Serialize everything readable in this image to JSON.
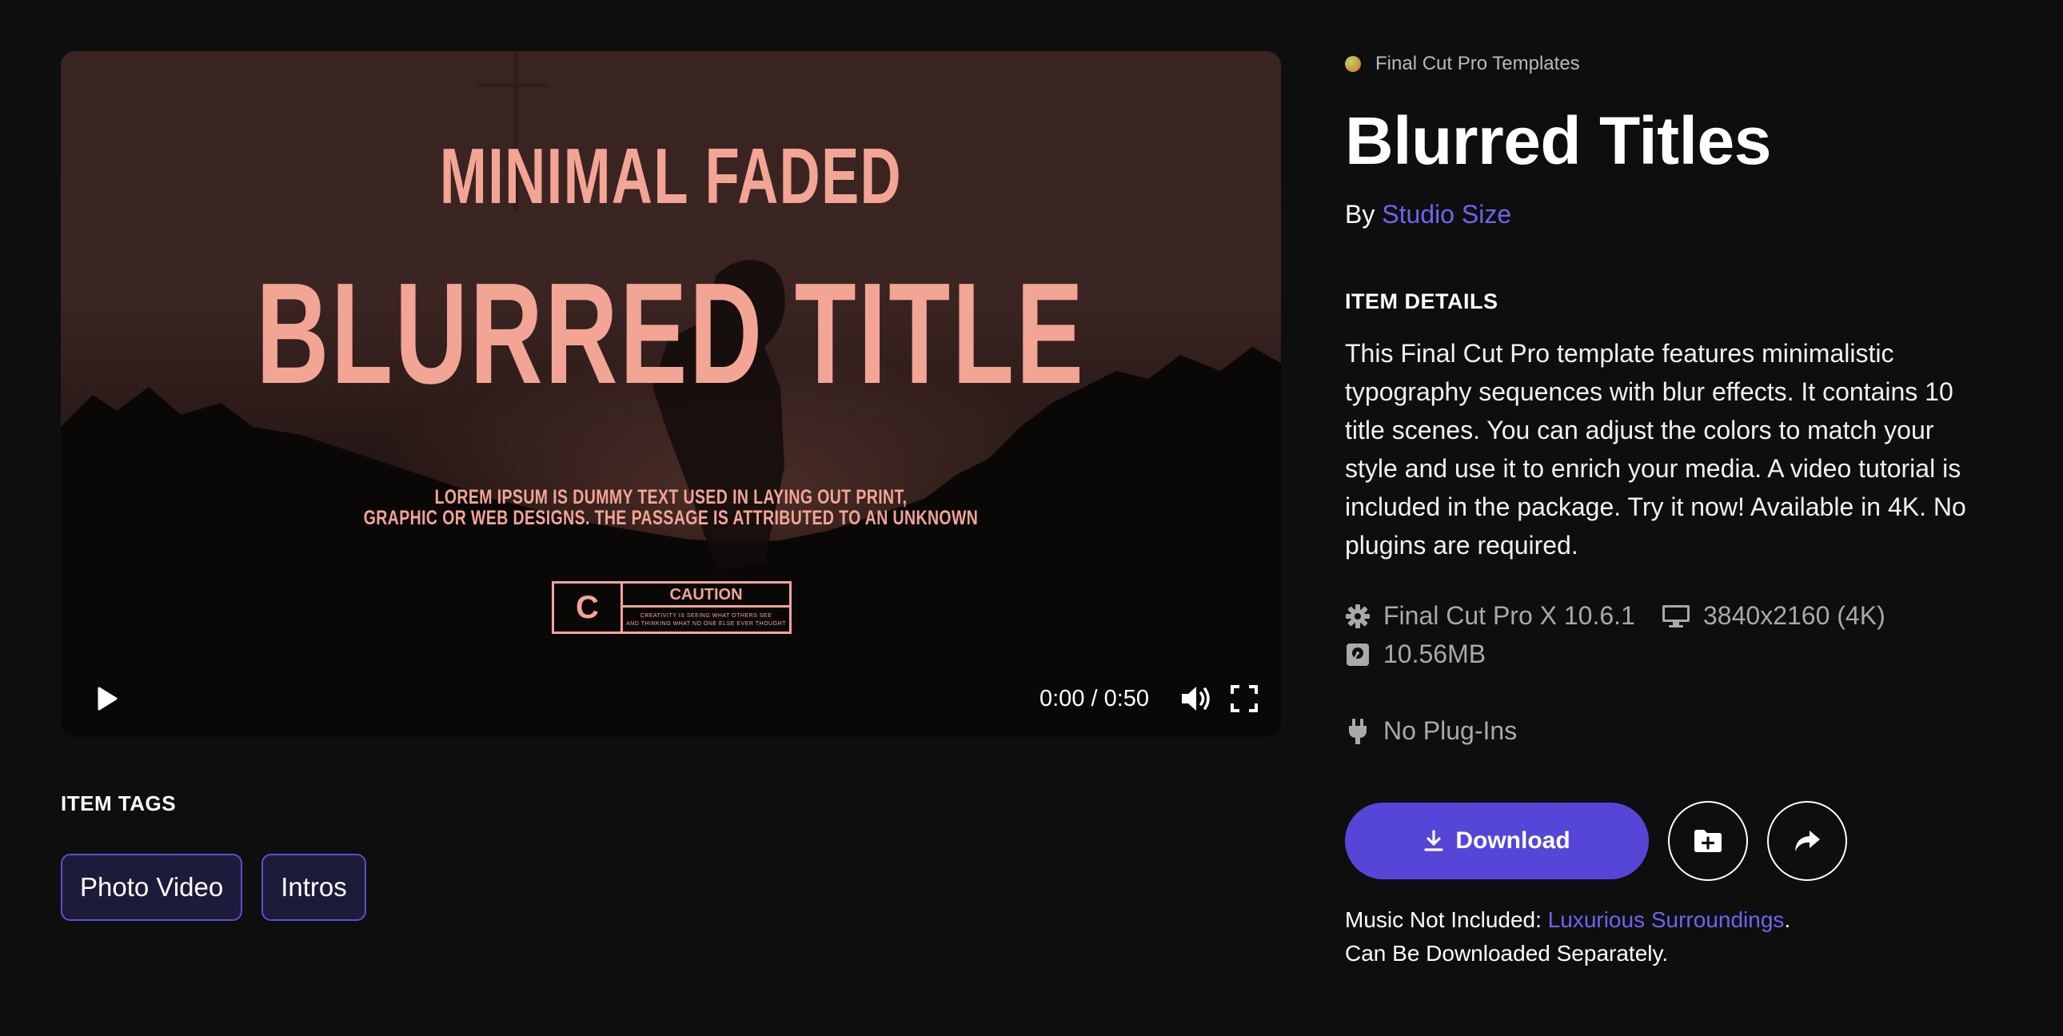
{
  "video": {
    "subhead": "MINIMAL FADED",
    "headline": "BLURRED TITLE",
    "lorem_line1": "LOREM IPSUM IS DUMMY TEXT USED IN LAYING OUT PRINT,",
    "lorem_line2": "GRAPHIC OR WEB DESIGNS. THE PASSAGE IS ATTRIBUTED TO AN UNKNOWN",
    "caution_letter": "C",
    "caution_title": "CAUTION",
    "caution_fine_1": "CREATIVITY IS SEEING WHAT OTHERS SEE",
    "caution_fine_2": "AND THINKING WHAT NO ONE ELSE EVER THOUGHT",
    "time_display": "0:00 / 0:50",
    "icons": {
      "play": "play-icon",
      "volume": "volume-icon",
      "fullscreen": "fullscreen-icon"
    }
  },
  "tags": {
    "heading": "ITEM TAGS",
    "items": [
      "Photo Video",
      "Intros"
    ]
  },
  "item": {
    "category": "Final Cut Pro Templates",
    "title": "Blurred Titles",
    "by_prefix": "By",
    "author": "Studio Size",
    "details_heading": "ITEM DETAILS",
    "description": "This Final Cut Pro template features minimalistic typography sequences with blur effects. It contains 10 title scenes. You can adjust the colors to match your style and use it to enrich your media. A video tutorial is included in the package. Try it now! Available in 4K. No plugins are required."
  },
  "specs": {
    "software": "Final Cut Pro X 10.6.1",
    "resolution": "3840x2160 (4K)",
    "size": "10.56MB",
    "plugins": "No Plug-Ins"
  },
  "actions": {
    "download_label": "Download",
    "add_to_collection_icon": "folder-plus-icon",
    "share_icon": "share-icon"
  },
  "music": {
    "prefix": "Music Not Included:",
    "track": "Luxurious Surroundings",
    "suffix": ".",
    "line2": "Can Be Downloaded Separately."
  },
  "colors": {
    "background": "#0e0e0f",
    "accent": "#5546d8",
    "link": "#6f63f0",
    "video_text": "#f2a595",
    "tag_bg": "#1d1b3a"
  }
}
